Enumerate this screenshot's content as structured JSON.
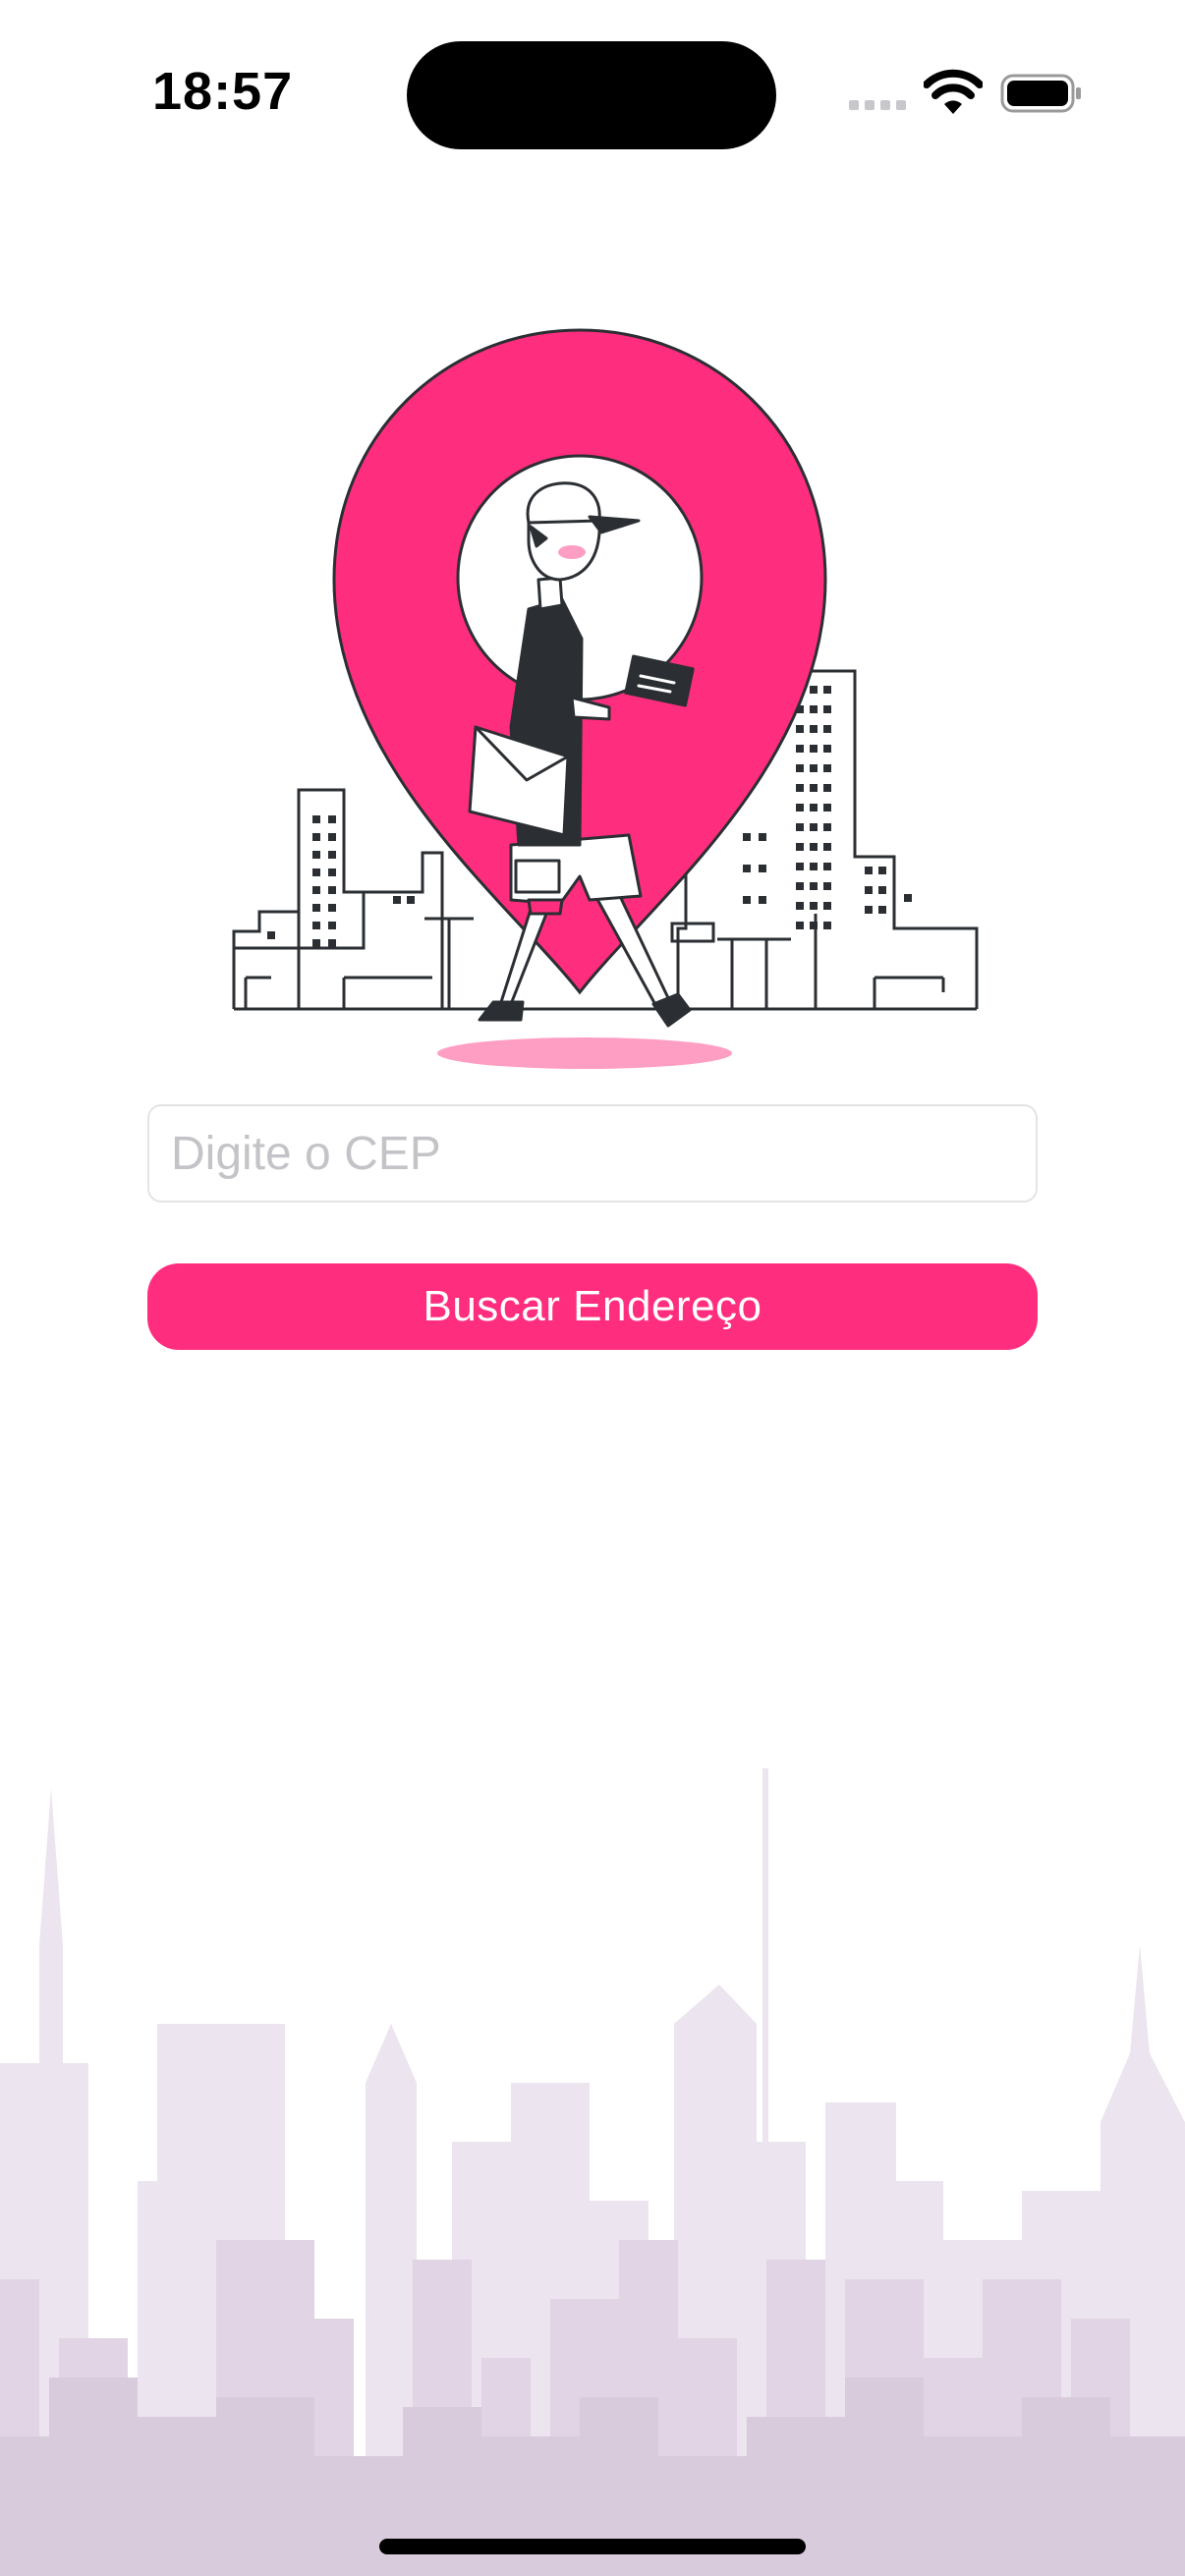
{
  "status_bar": {
    "time": "18:57",
    "icons": [
      "cellular-signal-icon",
      "wifi-icon",
      "battery-icon"
    ]
  },
  "hero": {
    "icon": "delivery-person-map-pin-illustration"
  },
  "form": {
    "cep_placeholder": "Digite o CEP",
    "cep_value": "",
    "search_label": "Buscar Endereço"
  },
  "colors": {
    "accent": "#ff2d7e",
    "accent_light": "#ff9ec3",
    "ink": "#2b2f33",
    "skyline": "#d8cbdc"
  }
}
